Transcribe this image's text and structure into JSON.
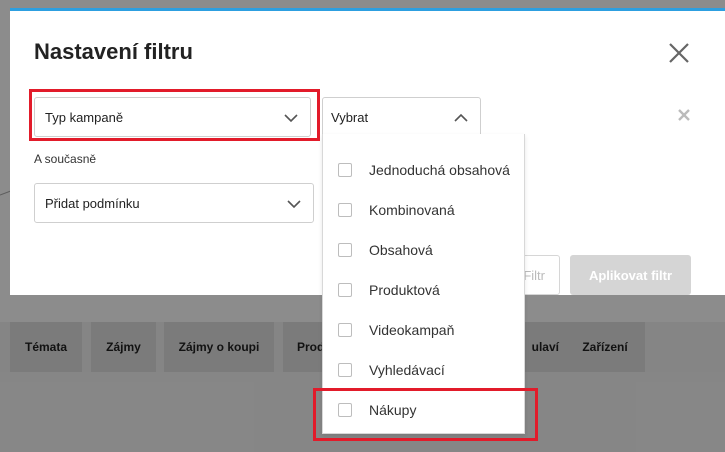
{
  "modal": {
    "title": "Nastavení filtru",
    "type_select": "Typ kampaně",
    "value_select": "Vybrat",
    "and_label": "A současně",
    "condition_select": "Přidat podmínku",
    "cancel_label": "Filtr",
    "apply_label": "Aplikovat filtr"
  },
  "dropdown": {
    "options": [
      "Jednoduchá obsahová",
      "Kombinovaná",
      "Obsahová",
      "Produktová",
      "Videokampaň",
      "Vyhledávací",
      "Nákupy"
    ]
  },
  "background": {
    "tabs": [
      "Témata",
      "Zájmy",
      "Zájmy o koupi",
      "Prod",
      "ulaví",
      "Zařízení"
    ]
  },
  "colors": {
    "accent": "#2d9fe0",
    "highlight": "#e21b2a",
    "apply_disabled": "#d5d5d5"
  },
  "icons": {
    "close": "close-icon",
    "remove": "remove-row-icon",
    "chevron_down": "chevron-down-icon",
    "chevron_up": "chevron-up-icon"
  }
}
